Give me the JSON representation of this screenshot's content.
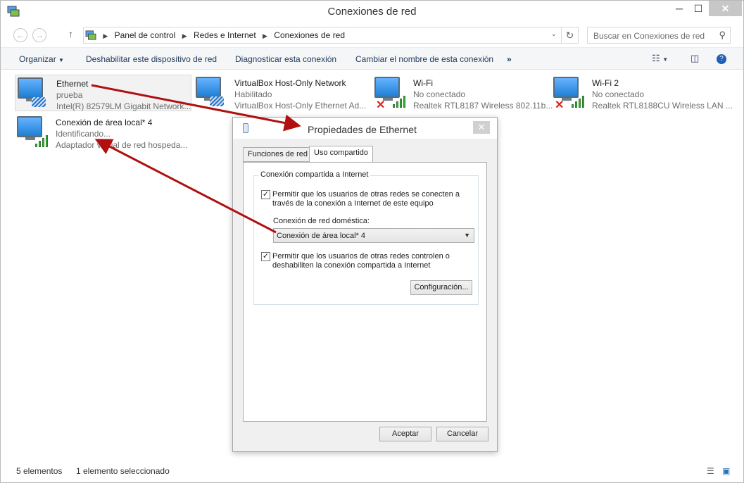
{
  "window": {
    "title": "Conexiones de red",
    "min_label": "─",
    "max_label": "☐",
    "close_label": "✕"
  },
  "address": {
    "breadcrumbs": [
      "Panel de control",
      "Redes e Internet",
      "Conexiones de red"
    ],
    "search_placeholder": "Buscar en Conexiones de red"
  },
  "command_bar": {
    "organize": "Organizar",
    "disable": "Deshabilitar este dispositivo de red",
    "diagnose": "Diagnosticar esta conexión",
    "rename": "Cambiar el nombre de esta conexión",
    "more": "»"
  },
  "connections": [
    {
      "name": "Ethernet",
      "status": "prueba",
      "adapter": "Intel(R) 82579LM Gigabit Network...",
      "type": "wired",
      "selected": true
    },
    {
      "name": "VirtualBox Host-Only Network",
      "status": "Habilitado",
      "adapter": "VirtualBox Host-Only Ethernet Ad...",
      "type": "wired",
      "selected": false
    },
    {
      "name": "Wi-Fi",
      "status": "No conectado",
      "adapter": "Realtek RTL8187 Wireless 802.11b...",
      "type": "wireless-disconnected",
      "selected": false
    },
    {
      "name": "Wi-Fi 2",
      "status": "No conectado",
      "adapter": "Realtek RTL8188CU Wireless LAN ...",
      "type": "wireless-disconnected",
      "selected": false
    },
    {
      "name": "Conexión de área local* 4",
      "status": "Identificando...",
      "adapter": "Adaptador virtual de red hospeda...",
      "type": "wireless",
      "selected": false
    }
  ],
  "status_bar": {
    "count": "5 elementos",
    "selected": "1 elemento seleccionado"
  },
  "dialog": {
    "title": "Propiedades de Ethernet",
    "close_label": "✕",
    "tabs": [
      "Funciones de red",
      "Uso compartido"
    ],
    "active_tab": "Uso compartido",
    "group_label": "Conexión compartida a Internet",
    "allow_connect": {
      "checked": true,
      "line1": "Permitir que los usuarios de otras redes se conecten a",
      "line2": "través de la conexión a Internet de este equipo"
    },
    "home_network_label": "Conexión de red doméstica:",
    "home_network_value": "Conexión de área local* 4",
    "allow_control": {
      "checked": true,
      "line1": "Permitir que los usuarios de otras redes controlen o",
      "line2": "deshabiliten la conexión compartida a Internet"
    },
    "settings_button": "Configuración...",
    "ok_button": "Aceptar",
    "cancel_button": "Cancelar"
  },
  "colors": {
    "annotation_arrow": "#b01010",
    "link_text": "#1e395b"
  }
}
